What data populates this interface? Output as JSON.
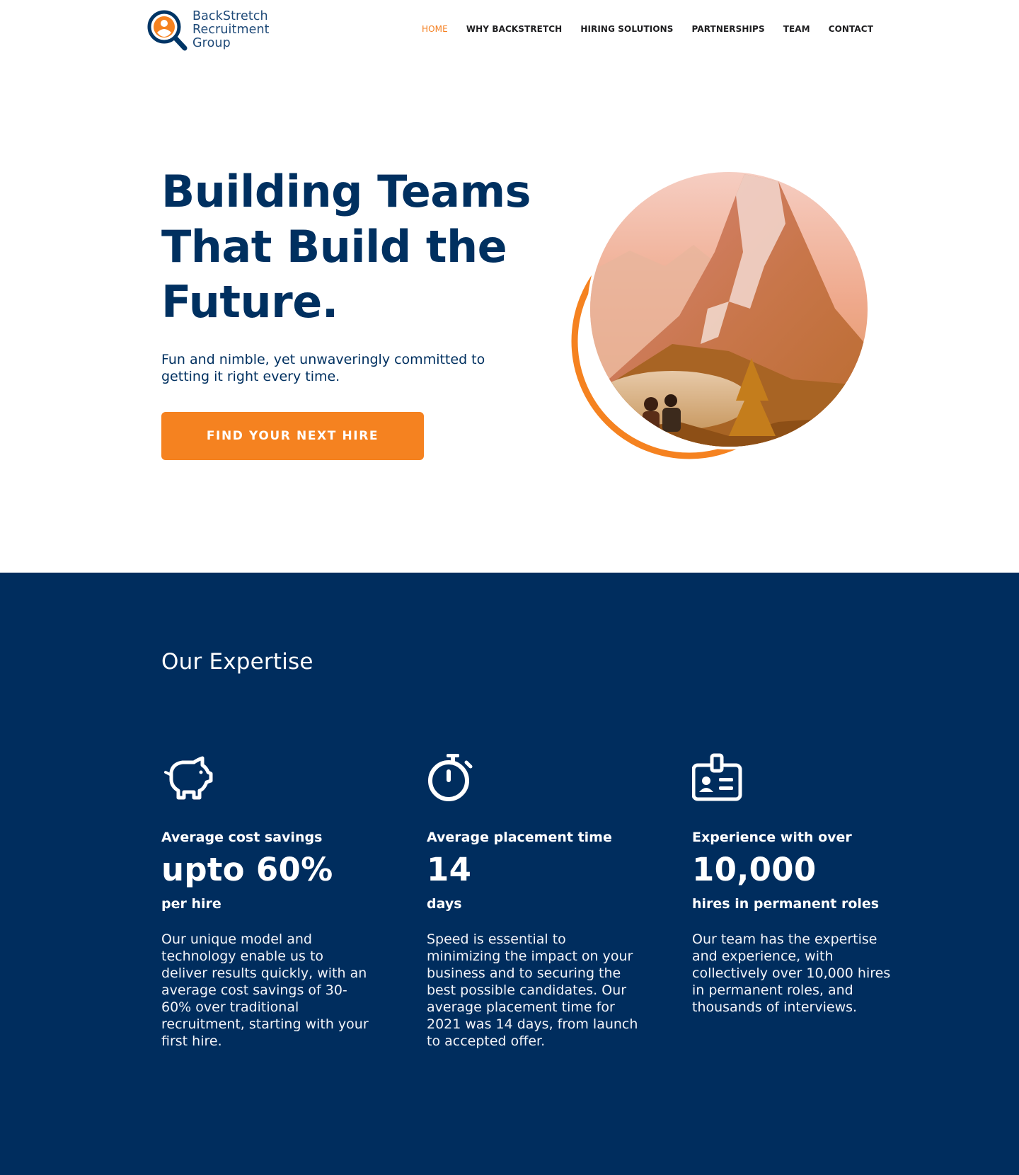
{
  "brand": {
    "line1": "BackStretch",
    "line2": "Recruitment",
    "line3": "Group",
    "colors": {
      "navy": "#002d5e",
      "orange": "#f58220"
    }
  },
  "nav": {
    "items": [
      {
        "label": "HOME"
      },
      {
        "label": "WHY BACKSTRETCH"
      },
      {
        "label": "HIRING SOLUTIONS"
      },
      {
        "label": "PARTNERSHIPS"
      },
      {
        "label": "TEAM"
      },
      {
        "label": "CONTACT"
      }
    ]
  },
  "hero": {
    "title_lines": [
      "Building Teams",
      "That Build the",
      "Future."
    ],
    "subtitle": "Fun and nimble, yet unwaveringly committed to getting it right every time.",
    "cta_label": "FIND YOUR NEXT HIRE",
    "image_icon": "mountain-lake-photo"
  },
  "expertise": {
    "title": "Our Expertise",
    "cards": [
      {
        "icon": "piggy-bank-icon",
        "label": "Average cost savings",
        "value": "upto 60%",
        "unit": "per hire",
        "description": "Our unique model and technology enable us to deliver results quickly, with an average cost savings of 30-60% over traditional recruitment, starting with your first hire."
      },
      {
        "icon": "stopwatch-icon",
        "label": "Average placement time",
        "value": "14",
        "unit": "days",
        "description": "Speed is essential to minimizing the impact on your business and to securing the best possible candidates. Our average placement time for 2021 was 14 days, from launch to accepted offer."
      },
      {
        "icon": "id-badge-icon",
        "label": "Experience with over",
        "value": "10,000",
        "unit": "hires in permanent roles",
        "description": "Our team has the expertise and experience, with collectively over 10,000 hires in permanent roles, and thousands of interviews."
      }
    ]
  }
}
